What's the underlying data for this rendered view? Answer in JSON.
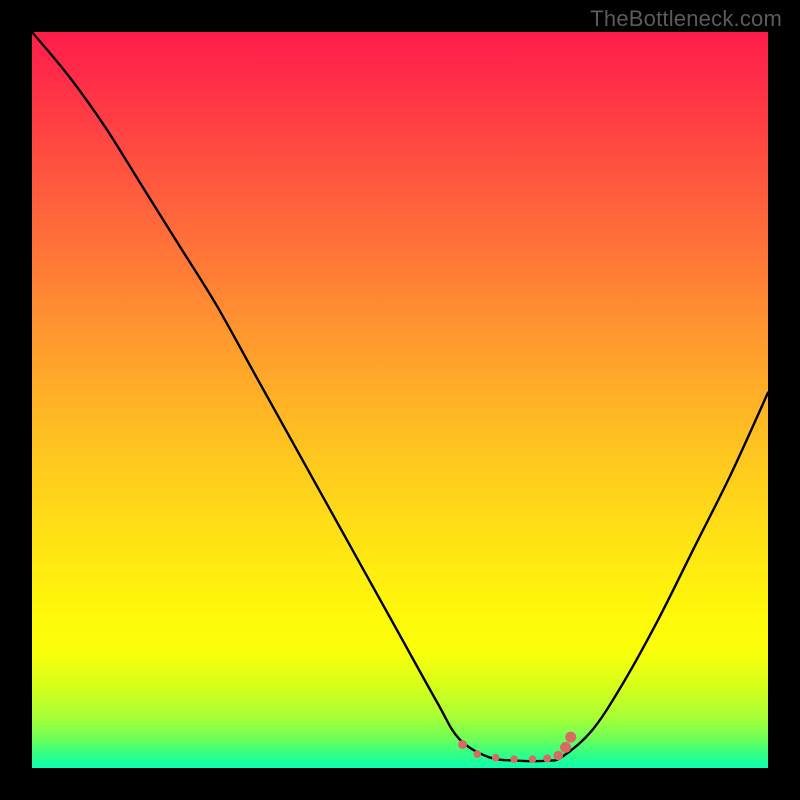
{
  "watermark": "TheBottleneck.com",
  "chart_data": {
    "type": "line",
    "title": "",
    "xlabel": "",
    "ylabel": "",
    "xlim": [
      0,
      100
    ],
    "ylim": [
      0,
      100
    ],
    "grid": false,
    "curve": {
      "x": [
        0,
        5,
        10,
        15,
        20,
        25,
        30,
        35,
        40,
        45,
        50,
        55,
        58,
        62,
        66,
        70,
        72,
        76,
        80,
        85,
        90,
        95,
        100
      ],
      "y": [
        100,
        94,
        87,
        79,
        71,
        63,
        54,
        45,
        36,
        27,
        18,
        9,
        4,
        1.5,
        1,
        1,
        1.5,
        5,
        11,
        20,
        30,
        40,
        51
      ]
    },
    "markers": {
      "color": "#D76A62",
      "points": [
        {
          "x": 58.5,
          "y": 3.2,
          "r": 4.5
        },
        {
          "x": 60.5,
          "y": 1.9,
          "r": 3.8
        },
        {
          "x": 63.0,
          "y": 1.4,
          "r": 3.8
        },
        {
          "x": 65.5,
          "y": 1.2,
          "r": 3.8
        },
        {
          "x": 68.0,
          "y": 1.2,
          "r": 3.8
        },
        {
          "x": 70.0,
          "y": 1.3,
          "r": 4.0
        },
        {
          "x": 71.5,
          "y": 1.7,
          "r": 4.8
        },
        {
          "x": 72.5,
          "y": 2.8,
          "r": 5.5
        },
        {
          "x": 73.2,
          "y": 4.2,
          "r": 5.5
        }
      ]
    }
  }
}
